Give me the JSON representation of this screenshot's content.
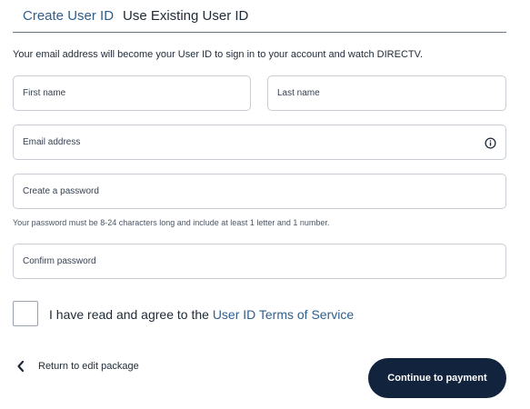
{
  "tabs": {
    "create": "Create User ID",
    "existing": "Use Existing User ID"
  },
  "intro": "Your email address will become your User ID to sign in to your account and watch DIRECTV.",
  "form": {
    "first_name_placeholder": "First name",
    "last_name_placeholder": "Last name",
    "email_placeholder": "Email address",
    "email_icon": "info-icon",
    "password_placeholder": "Create a password",
    "password_hint": "Your password must be 8-24 characters long and include at least 1 letter and 1 number.",
    "confirm_placeholder": "Confirm password"
  },
  "agreement": {
    "text": "I have read and agree to the",
    "link": "User ID Terms of Service"
  },
  "footer": {
    "return_label": "Return to edit package",
    "return_icon": "chevron-left-icon",
    "continue_label": "Continue to payment"
  },
  "colors": {
    "link": "#2f5f8f",
    "primary_button": "#12233d",
    "text": "#1f2a37"
  }
}
